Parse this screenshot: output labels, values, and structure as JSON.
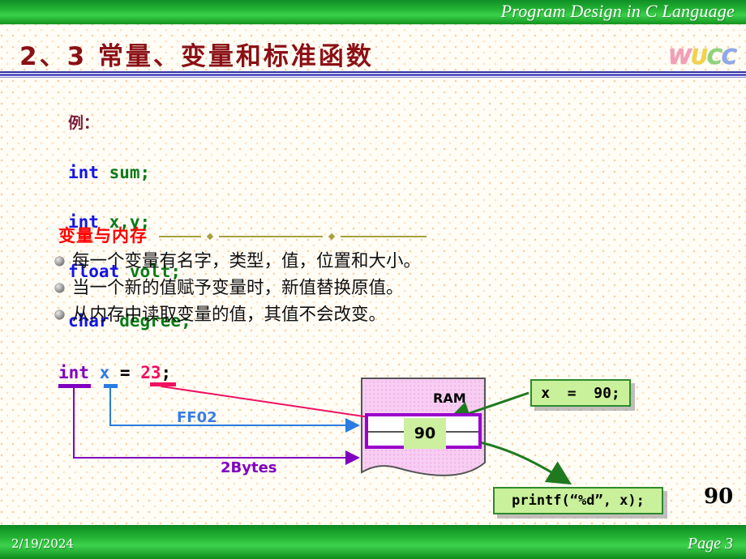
{
  "header": {
    "course_title": "Program Design in C Language",
    "logo_letters": [
      "W",
      "U",
      "C",
      "C"
    ]
  },
  "title": {
    "text": "2、3  常量、变量和标准函数"
  },
  "code_example": {
    "label": "例：",
    "lines": [
      {
        "keyword": "int",
        "rest": " sum;"
      },
      {
        "keyword": "int",
        "rest": " x,y;"
      },
      {
        "keyword": "float",
        "rest": " volt;"
      },
      {
        "keyword": "char",
        "rest": " degree;"
      }
    ]
  },
  "section": {
    "heading": "变量与内存",
    "bullets": [
      "每一个变量有名字，类型，值，位置和大小。",
      "当一个新的值赋予变量时，新值替换原值。",
      "从内存中读取变量的值，其值不会改变。"
    ]
  },
  "diagram": {
    "declaration": {
      "type": "int",
      "name": "x",
      "operator": "=",
      "value": "23",
      "terminator": ";"
    },
    "address_label": "FF02",
    "size_label": "2Bytes",
    "ram": {
      "label": "RAM",
      "cell_value": "90"
    },
    "callout_assign": "x  =  90;",
    "callout_printf": "printf(“%d”, x);",
    "output_value": "90"
  },
  "footer": {
    "date": "2/19/2024",
    "page": "Page  3"
  },
  "colors": {
    "band_green": "#24b434",
    "title_red": "#8b1015",
    "heading_red": "#ff0000",
    "keyword_blue": "#1414e6",
    "identifier_green": "#0b7a18",
    "type_purple": "#8000c0",
    "var_blue": "#2a7ce0",
    "value_pink": "#f01060",
    "ram_pink": "#f6c8f0",
    "cell_border_purple": "#9900cc",
    "callout_green": "#c9f09a",
    "arrow_green": "#1f7a1f"
  }
}
